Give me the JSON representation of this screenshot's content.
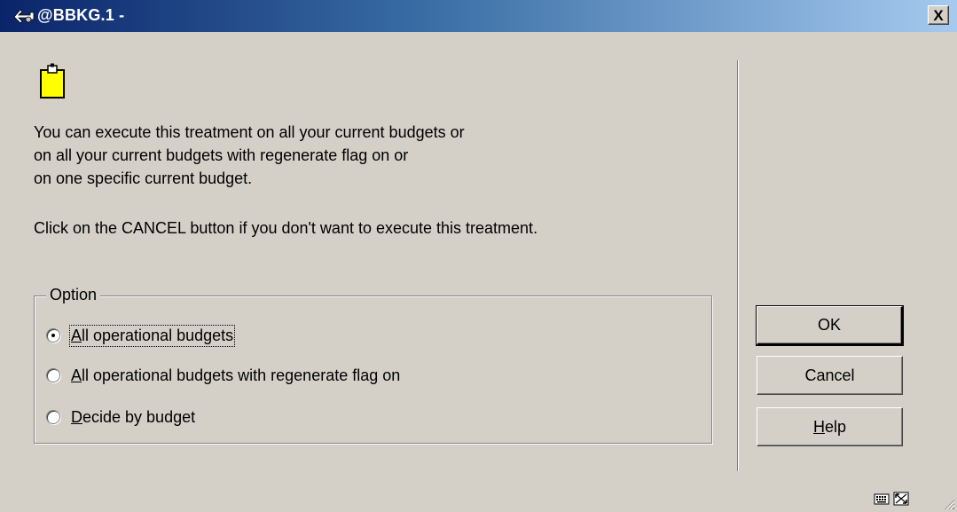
{
  "window": {
    "title": "@BBKG.1 -",
    "close_label": "X",
    "app_icon": "key-ring-icon"
  },
  "icon": "clipboard-icon",
  "message": {
    "lines": [
      "You can execute this treatment on all your current budgets or",
      "on all your current budgets with regenerate flag on or",
      "on one specific current budget."
    ],
    "cancel_hint": "Click on the CANCEL button if you don't want to execute this treatment."
  },
  "option_group": {
    "legend": "Option",
    "options": [
      {
        "mnemonic": "A",
        "rest": "ll operational budgets",
        "selected": true
      },
      {
        "mnemonic": "A",
        "rest": "ll operational budgets with regenerate flag on",
        "selected": false
      },
      {
        "mnemonic": "D",
        "rest": "ecide by budget",
        "selected": false
      }
    ]
  },
  "buttons": {
    "ok": "OK",
    "cancel": "Cancel",
    "help_mnemonic": "H",
    "help_rest": "elp"
  },
  "status_bar": {
    "icons": [
      "keyboard-icon",
      "resize-window-icon",
      "size-grip-icon"
    ]
  },
  "colors": {
    "dialog_bg": "#d4d0c8",
    "titlebar_start": "#0a246a",
    "titlebar_end": "#a6caf0",
    "clipboard_fill": "#ffff00"
  }
}
